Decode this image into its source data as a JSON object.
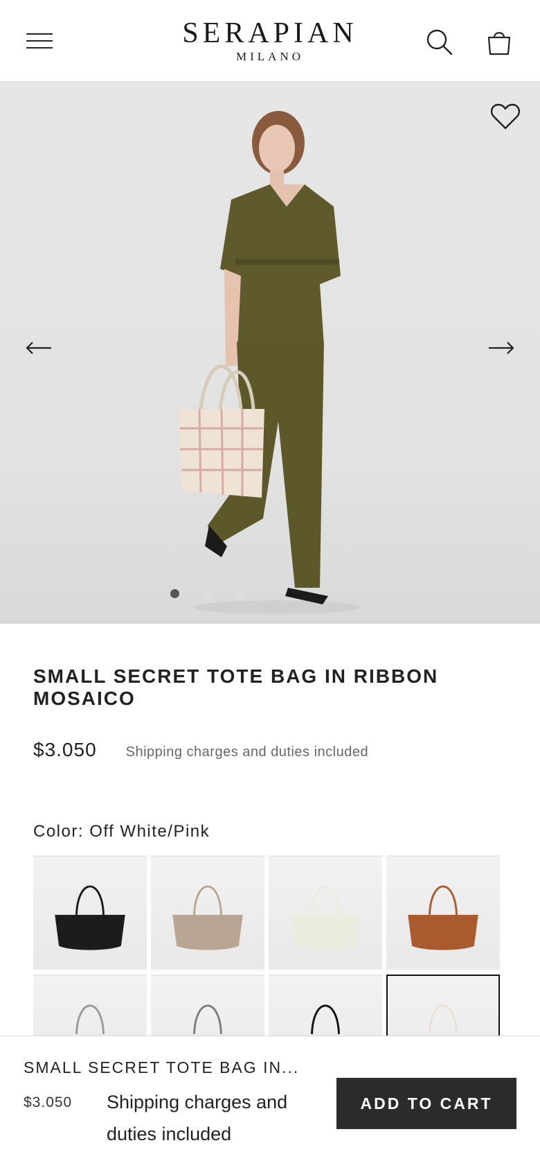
{
  "header": {
    "logo_main": "SERAPIAN",
    "logo_sub": "MILANO",
    "menu_icon": "hamburger-menu-icon",
    "search_icon": "search-icon",
    "bag_icon": "shopping-bag-icon"
  },
  "gallery": {
    "wishlist_icon": "heart-icon",
    "prev_icon": "arrow-left-icon",
    "next_icon": "arrow-right-icon",
    "dots_total": 3,
    "active_dot": 1
  },
  "product": {
    "title": "SMALL SECRET TOTE BAG IN RIBBON MOSAICO",
    "price": "$3.050",
    "shipping_note": "Shipping charges and duties included",
    "color_label": "Color: Off White/Pink",
    "swatches": [
      {
        "color": "#1c1c1c",
        "selected": false
      },
      {
        "color": "#b9a593",
        "selected": false
      },
      {
        "color": "#ecebe0",
        "selected": false
      },
      {
        "color": "#a95a2f",
        "selected": false
      },
      {
        "color": "#9a9a9a",
        "selected": false
      },
      {
        "color": "#7d7d7d",
        "selected": false
      },
      {
        "color": "#111111",
        "selected": false
      },
      {
        "color": "#e8e2d6",
        "selected": true
      }
    ]
  },
  "sticky_bar": {
    "title": "SMALL SECRET TOTE BAG IN...",
    "price": "$3.050",
    "shipping_note": "Shipping charges and duties included",
    "add_to_cart_label": "ADD TO CART"
  },
  "colors": {
    "accent": "#2b2b2b",
    "background": "#ffffff",
    "hero_background": "#e4e4e4"
  }
}
